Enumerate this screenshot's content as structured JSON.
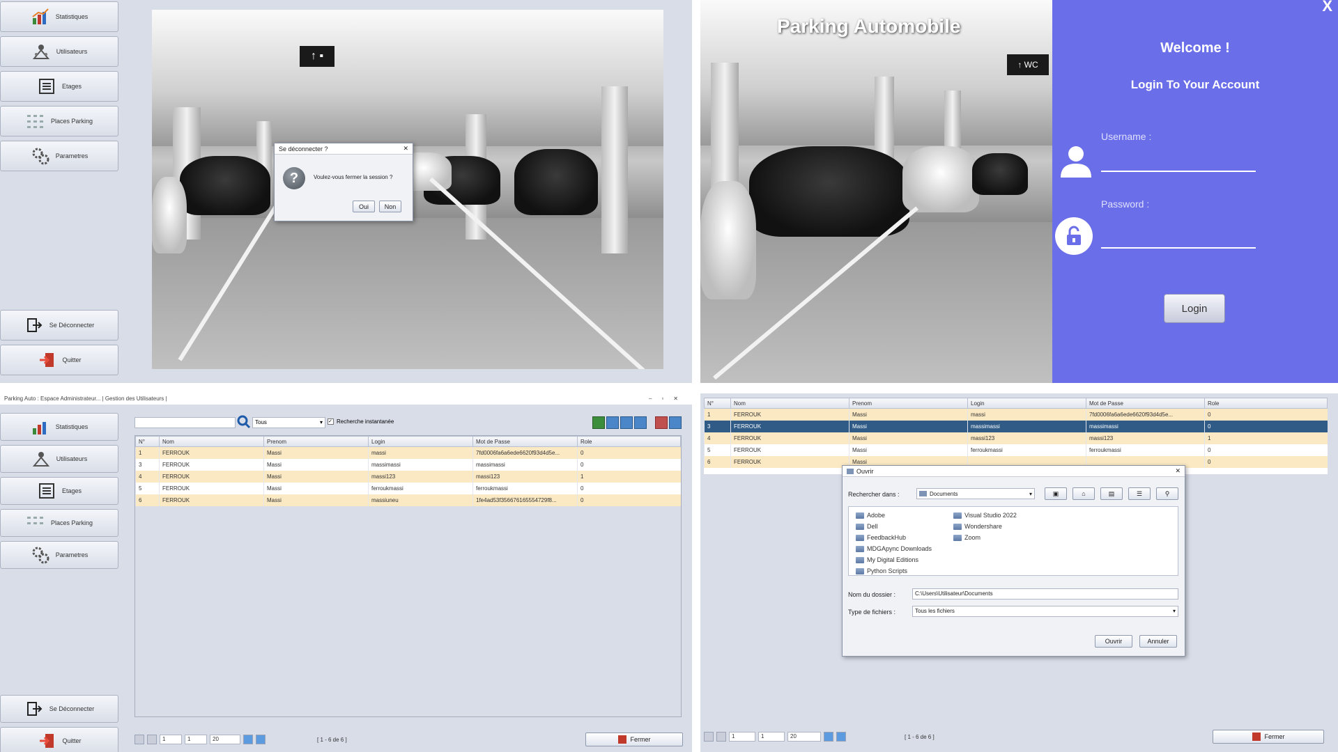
{
  "sidebar": {
    "items": [
      {
        "label": "Statistiques",
        "icon": "chart-icon"
      },
      {
        "label": "Utilisateurs",
        "icon": "users-icon"
      },
      {
        "label": "Etages",
        "icon": "list-icon"
      },
      {
        "label": "Places Parking",
        "icon": "grid-icon"
      },
      {
        "label": "Parametres",
        "icon": "gears-icon"
      }
    ],
    "logout_label": "Se Déconnecter",
    "quit_label": "Quitter"
  },
  "logout_dialog": {
    "title": "Se déconnecter ?",
    "message": "Voulez-vous fermer la session ?",
    "yes_label": "Oui",
    "no_label": "Non"
  },
  "login": {
    "app_title": "Parking Automobile",
    "close_label": "X",
    "welcome": "Welcome !",
    "subtitle": "Login To Your Account",
    "username_label": "Username :",
    "password_label": "Password :",
    "username_value": "",
    "password_value": "",
    "login_button": "Login",
    "colors": {
      "panel": "#6a6ee8"
    }
  },
  "users_window": {
    "title": "Parking Auto : Espace Administrateur... | Gestion des Utilisateurs |",
    "search_value": "",
    "filter_value": "Tous",
    "instant_search_label": "Recherche instantanée",
    "columns": [
      "N°",
      "Nom",
      "Prenom",
      "Login",
      "Mot de Passe",
      "Role"
    ],
    "rows": [
      [
        "1",
        "FERROUK",
        "Massi",
        "massi",
        "7fd0006fa6a6ede6620f93d4d5e...",
        "0"
      ],
      [
        "3",
        "FERROUK",
        "Massi",
        "massimassi",
        "massimassi",
        "0"
      ],
      [
        "4",
        "FERROUK",
        "Massi",
        "massi123",
        "massi123",
        "1"
      ],
      [
        "5",
        "FERROUK",
        "Massi",
        "ferroukmassi",
        "ferroukmassi",
        "0"
      ],
      [
        "6",
        "FERROUK",
        "Massi",
        "massiuneu",
        "1fe4ad53f356676165554729f8...",
        "0"
      ]
    ],
    "pager": {
      "page": "1",
      "pages": "1",
      "per_page": "20",
      "range": "[ 1 - 6 de 6 ]"
    },
    "close_label": "Fermer"
  },
  "open_dialog_window": {
    "columns": [
      "N°",
      "Nom",
      "Prenom",
      "Login",
      "Mot de Passe",
      "Role"
    ],
    "rows": [
      [
        "1",
        "FERROUK",
        "Massi",
        "massi",
        "7fd0006fa6a6ede6620f93d4d5e...",
        "0"
      ],
      [
        "3",
        "FERROUK",
        "Massi",
        "massimassi",
        "massimassi",
        "0"
      ],
      [
        "4",
        "FERROUK",
        "Massi",
        "massi123",
        "massi123",
        "1"
      ],
      [
        "5",
        "FERROUK",
        "Massi",
        "ferroukmassi",
        "ferroukmassi",
        "0"
      ],
      [
        "6",
        "FERROUK",
        "Massi",
        "",
        "",
        "0"
      ]
    ],
    "selected_row": 1,
    "dialog": {
      "title": "Ouvrir",
      "look_in_label": "Rechercher dans :",
      "look_in_value": "Documents",
      "folders_col1": [
        "Adobe",
        "Dell",
        "FeedbackHub",
        "MDGApync Downloads",
        "My Digital Editions",
        "Python Scripts"
      ],
      "folders_col2": [
        "Visual Studio 2022",
        "Wondershare",
        "Zoom"
      ],
      "folder_name_label": "Nom du dossier :",
      "folder_name_value": "C:\\Users\\Utilisateur\\Documents",
      "file_type_label": "Type de fichiers :",
      "file_type_value": "Tous les fichiers",
      "open_label": "Ouvrir",
      "cancel_label": "Annuler"
    },
    "pager": {
      "page": "1",
      "pages": "1",
      "per_page": "20",
      "range": "[ 1 - 6 de 6 ]"
    },
    "close_label": "Fermer"
  }
}
